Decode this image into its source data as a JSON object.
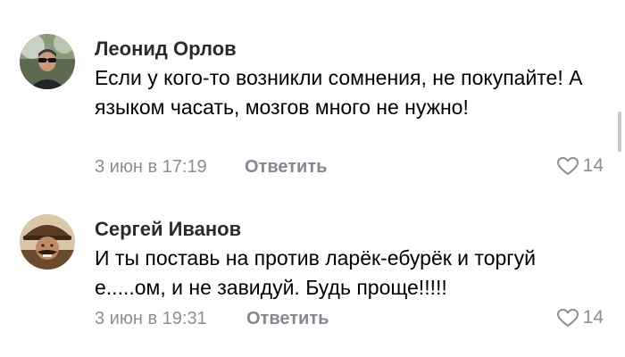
{
  "comments": [
    {
      "author": "Леонид Орлов",
      "text": "Если у кого-то возникли сомнения, не покупайте! А языком часать, мозгов много не нужно!",
      "date": "3 июн в 17:19",
      "reply_label": "Ответить",
      "likes": "14",
      "avatar_icon": "user-photo-sunglasses"
    },
    {
      "author": "Сергей Иванов",
      "text": "И ты поставь на против ларёк-ебурёк и торгуй е.....ом,  и не завидуй. Будь проще!!!!!",
      "date": "3 июн в 19:31",
      "reply_label": "Ответить",
      "likes": "14",
      "avatar_icon": "user-photo-hat-mustache"
    }
  ],
  "colors": {
    "meta": "#8d8e93",
    "reply": "#838890",
    "author": "#2b2b2b"
  }
}
